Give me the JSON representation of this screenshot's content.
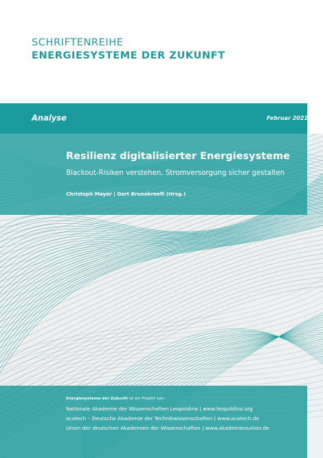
{
  "series": {
    "line1": "SCHRIFTENREIHE",
    "line2": "ENERGIESYSTEME DER ZUKUNFT"
  },
  "band": {
    "type": "Analyse",
    "date": "Februar 2021"
  },
  "title_box": {
    "title": "Resilienz digitalisierter Energiesysteme",
    "subtitle": "Blackout-Risiken verstehen, Stromversorgung sicher gestalten",
    "authors": "Christoph Mayer | Gert Brunekreeft (Hrsg.)"
  },
  "footer": {
    "intro_bold": "Energiesysteme der Zukunft",
    "intro_rest": " ist ein Projekt von:",
    "lines": [
      "Nationale Akademie der Wissenschaften Leopoldina | www.leopoldina.org",
      "acatech – Deutsche Akademie der Technikwissenschaften | www.acatech.de",
      "Union der deutschen Akademien der Wissenschaften | www.akademienunion.de"
    ]
  },
  "colors": {
    "teal": "#1a9a9a",
    "series_text": "#1c9c9c",
    "curve_grey": "#9aa3a8",
    "art_background": "#eef1f2"
  }
}
